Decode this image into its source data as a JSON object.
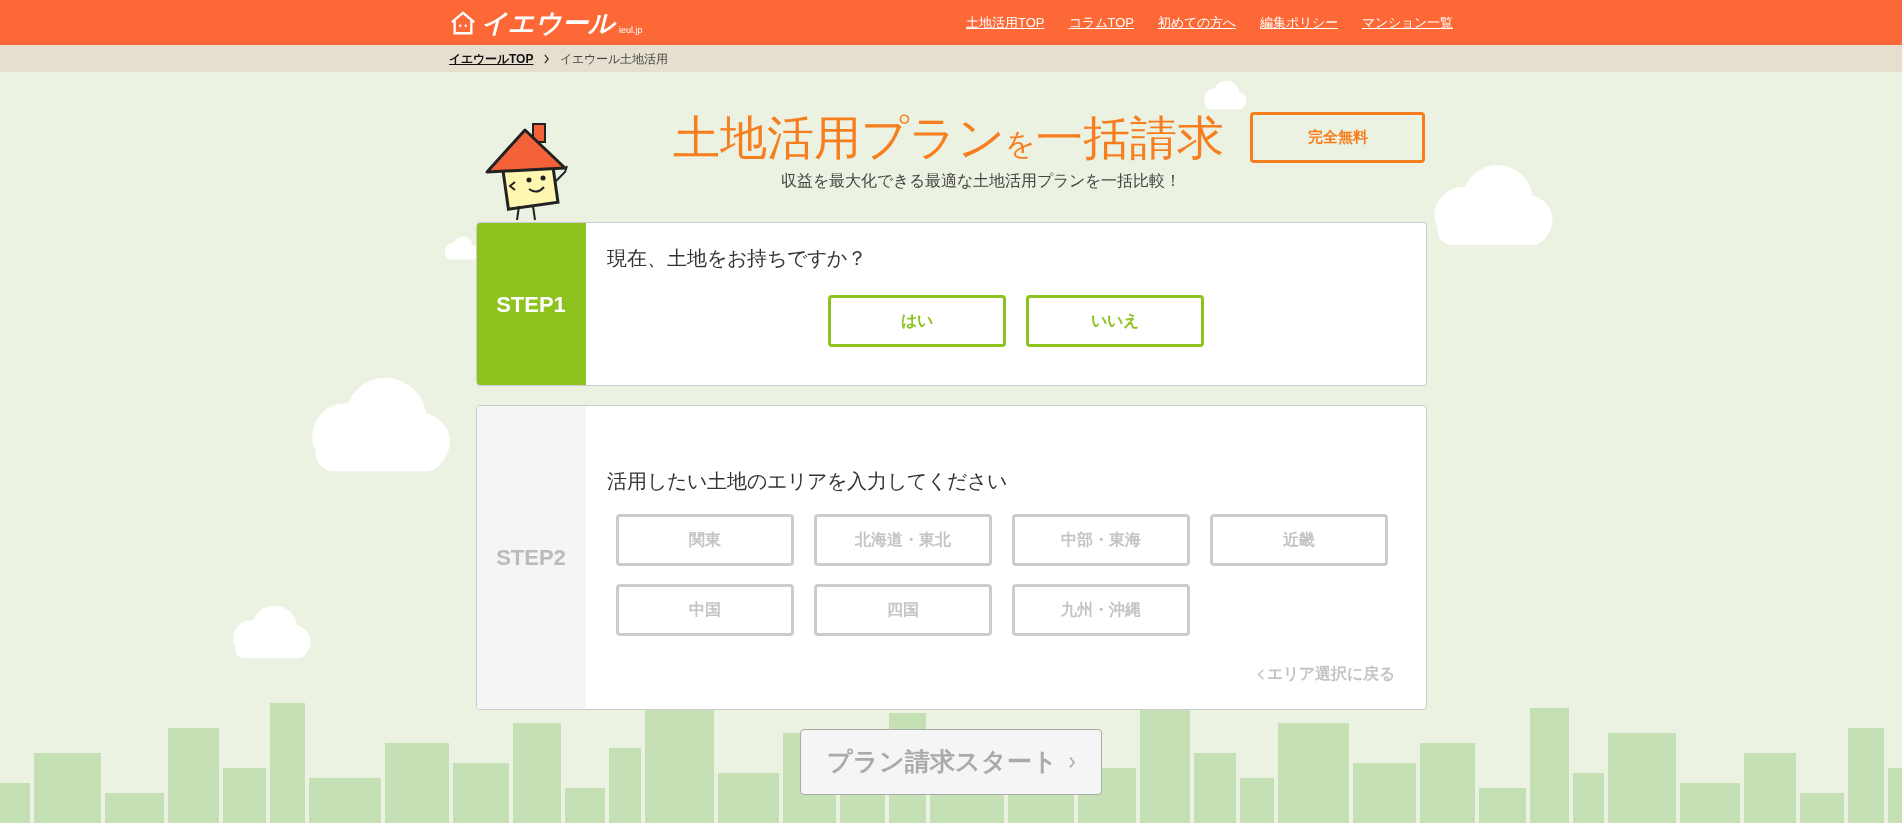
{
  "header": {
    "logo": {
      "text": "イエウール",
      "sub": "ieul.jp"
    },
    "nav": [
      {
        "label": "土地活用TOP"
      },
      {
        "label": "コラムTOP"
      },
      {
        "label": "初めての方へ"
      },
      {
        "label": "編集ポリシー"
      },
      {
        "label": "マンション一覧"
      }
    ]
  },
  "breadcrumb": [
    {
      "label": "イエウールTOP",
      "current": false
    },
    {
      "label": "イエウール土地活用",
      "current": true
    }
  ],
  "hero": {
    "title": {
      "main": "土地活用プラン",
      "particle": "を",
      "rest": "一括請求"
    },
    "badge": "完全無料",
    "subtitle": "収益を最大化できる最適な土地活用プランを一括比較！"
  },
  "steps": [
    {
      "label": "STEP1",
      "active": true,
      "kind": "yes_no",
      "question": "現在、土地をお持ちですか？",
      "options": [
        "はい",
        "いいえ"
      ]
    },
    {
      "label": "STEP2",
      "active": false,
      "kind": "area",
      "question": "活用したい土地のエリアを入力してください",
      "options": [
        "関東",
        "北海道・東北",
        "中部・東海",
        "近畿",
        "中国",
        "四国",
        "九州・沖縄"
      ],
      "back_link": "エリア選択に戻る"
    }
  ],
  "submit": {
    "label": "プラン請求スタート",
    "disabled": true
  }
}
